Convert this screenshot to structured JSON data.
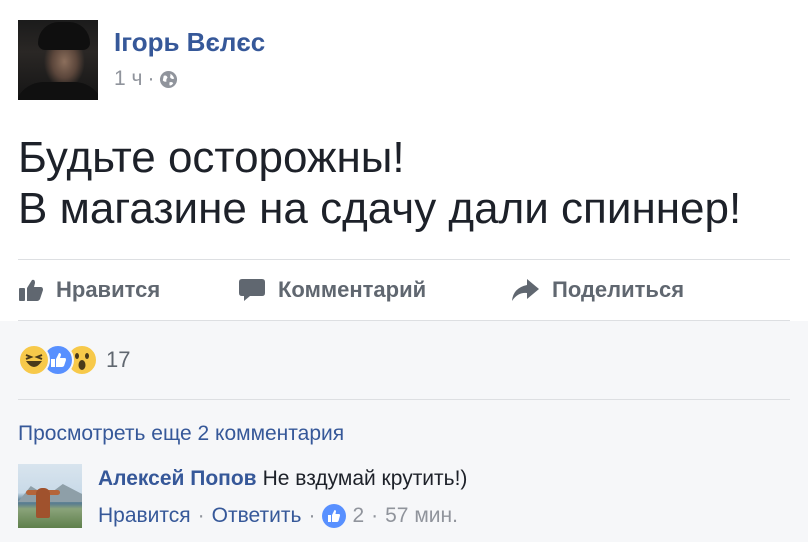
{
  "post": {
    "author": "Ігорь Вєлєс",
    "time": "1 ч",
    "separator": "·",
    "privacy_icon": "globe-icon",
    "text_line1": "Будьте осторожны!",
    "text_line2": "В магазине на сдачу дали спиннер!"
  },
  "actions": {
    "like_label": "Нравится",
    "comment_label": "Комментарий",
    "share_label": "Поделиться"
  },
  "reactions": {
    "icons": [
      "haha-reaction-icon",
      "like-reaction-icon",
      "wow-reaction-icon"
    ],
    "count": "17"
  },
  "comments": {
    "view_more": "Просмотреть еще 2 комментария",
    "items": [
      {
        "author": "Алексей Попов",
        "text": "Не вздумай крутить!)",
        "like_label": "Нравится",
        "reply_label": "Ответить",
        "likes": "2",
        "time": "57 мин.",
        "separator": "·"
      }
    ]
  },
  "colors": {
    "link_blue": "#365899",
    "muted_gray": "#90949c",
    "action_gray": "#606770",
    "like_blue": "#5890ff",
    "reaction_yellow": "#f7c94a",
    "lower_bg": "#f6f7f9"
  }
}
